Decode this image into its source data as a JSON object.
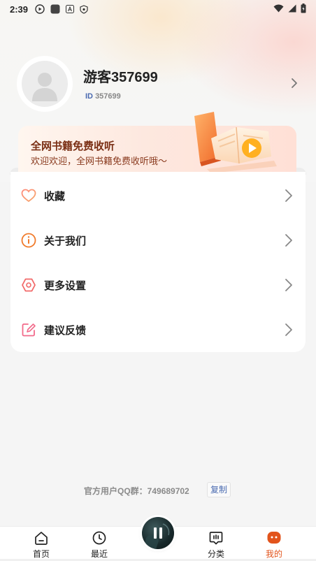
{
  "status_bar": {
    "time": "2:39"
  },
  "profile": {
    "username": "游客357699",
    "id_label": "ID",
    "id_value": "357699"
  },
  "banner": {
    "title": "全网书籍免费收听",
    "subtitle": "欢迎欢迎，全网书籍免费收听哦～"
  },
  "menu": {
    "items": [
      {
        "label": "收藏",
        "icon": "heart-icon"
      },
      {
        "label": "关于我们",
        "icon": "info-icon"
      },
      {
        "label": "更多设置",
        "icon": "settings-hexagon-icon"
      },
      {
        "label": "建议反馈",
        "icon": "edit-icon"
      }
    ]
  },
  "footer": {
    "qq_text": "官方用户QQ群：749689702",
    "copy_label": "复制"
  },
  "bottom_nav": {
    "items": [
      {
        "label": "首页",
        "icon": "home-icon",
        "active": false
      },
      {
        "label": "最近",
        "icon": "clock-icon",
        "active": false
      },
      {
        "label": "分类",
        "icon": "category-icon",
        "active": false
      },
      {
        "label": "我的",
        "icon": "profile-icon",
        "active": true
      }
    ]
  },
  "colors": {
    "accent": "#e2541c",
    "banner_title": "#7a2f14",
    "link": "#4a6ab0"
  }
}
